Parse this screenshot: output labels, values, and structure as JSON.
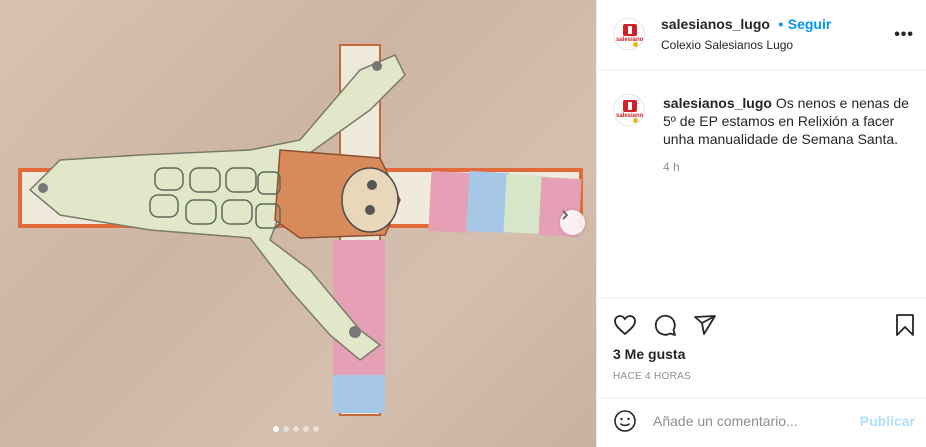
{
  "post": {
    "username": "salesianos_lugo",
    "follow_separator": "•",
    "follow_label": "Seguir",
    "location": "Colexio Salesianos Lugo",
    "more_label": "•••",
    "avatar_text": "salesianos"
  },
  "caption": {
    "username": "salesianos_lugo",
    "text": "Os nenos e nenas de 5º de EP estamos en Relixión a facer unha manualidade de Semana Santa.",
    "time": "4 h"
  },
  "actions": {
    "likes": "3 Me gusta",
    "posted": "HACE 4 HORAS"
  },
  "comment": {
    "placeholder": "Añade un comentario...",
    "publish_label": "Publicar"
  },
  "carousel": {
    "total": 5,
    "active": 0
  },
  "colors": {
    "accent": "#0095f6",
    "publish_disabled": "#b2dffc",
    "muted": "#8e8e8e"
  }
}
